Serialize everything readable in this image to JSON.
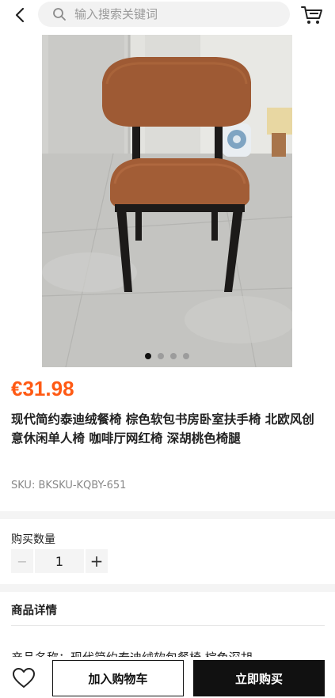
{
  "header": {
    "search_placeholder": "输入搜索关键词"
  },
  "gallery": {
    "image_count": 4,
    "active_index": 0
  },
  "product": {
    "price": "€31.98",
    "title": "现代简约泰迪绒餐椅 棕色软包书房卧室扶手椅 北欧风创意休闲单人椅 咖啡厅网红椅 深胡桃色椅腿",
    "sku": "SKU: BKSKU-KQBY-651"
  },
  "quantity": {
    "label": "购买数量",
    "value": "1",
    "minus": "−",
    "plus": "+"
  },
  "details": {
    "title": "商品详情",
    "preview_text": "产品名称：现代简约泰迪绒软包餐椅 棕色深胡"
  },
  "actions": {
    "add_to_cart": "加入购物车",
    "buy_now": "立即购买"
  },
  "colors": {
    "price": "#ff5a14",
    "primary_button": "#111111"
  }
}
